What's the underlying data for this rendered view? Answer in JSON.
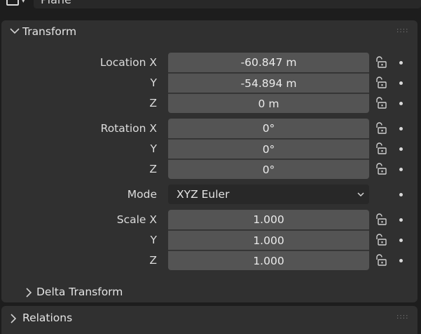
{
  "object": {
    "name": "Plane"
  },
  "transform": {
    "header": "Transform",
    "rows": [
      {
        "label": "Location X",
        "value": "-60.847 m"
      },
      {
        "label": "Y",
        "value": "-54.894 m"
      },
      {
        "label": "Z",
        "value": "0 m"
      },
      {
        "label": "Rotation X",
        "value": "0°"
      },
      {
        "label": "Y",
        "value": "0°"
      },
      {
        "label": "Z",
        "value": "0°"
      },
      {
        "label": "Scale X",
        "value": "1.000"
      },
      {
        "label": "Y",
        "value": "1.000"
      },
      {
        "label": "Z",
        "value": "1.000"
      }
    ],
    "mode": {
      "label": "Mode",
      "value": "XYZ Euler"
    }
  },
  "delta_transform": {
    "header": "Delta Transform"
  },
  "relations": {
    "header": "Relations"
  },
  "icons": {
    "grip": "grip-dots-icon",
    "lock": "unlocked-padlock-icon",
    "animate": "animate-dot-icon"
  }
}
